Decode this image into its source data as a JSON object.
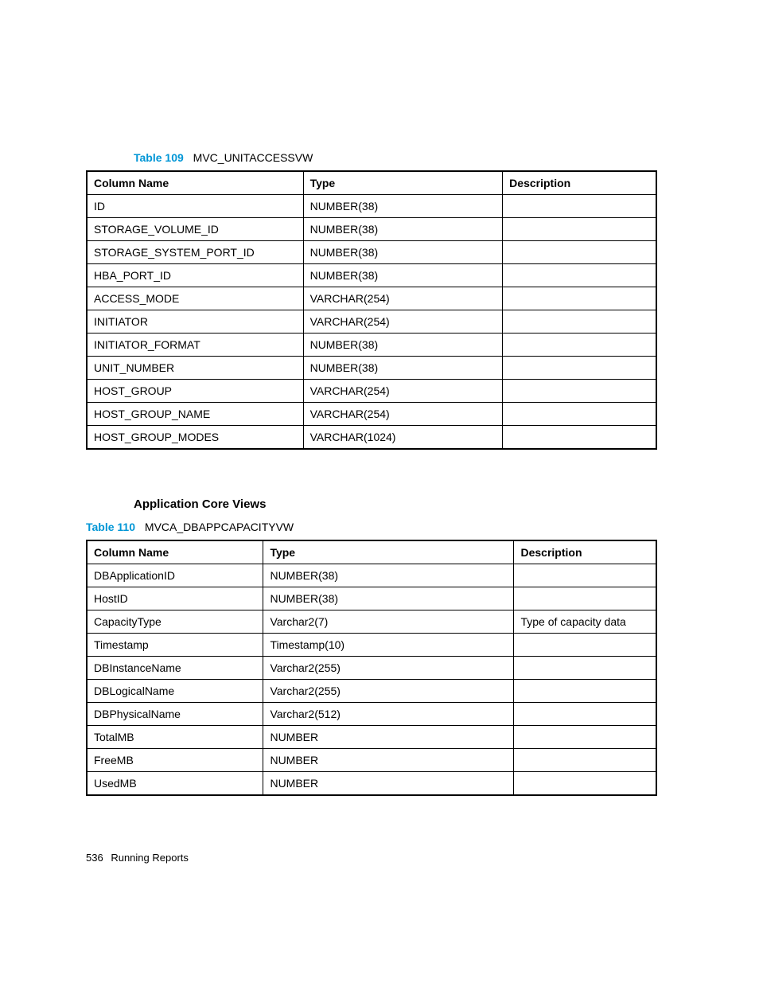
{
  "table1": {
    "caption_label": "Table 109",
    "caption_name": "MVC_UNITACCESSVW",
    "headers": {
      "col1": "Column Name",
      "col2": "Type",
      "col3": "Description"
    },
    "rows": [
      {
        "col1": "ID",
        "col2": "NUMBER(38)",
        "col3": ""
      },
      {
        "col1": "STORAGE_VOLUME_ID",
        "col2": "NUMBER(38)",
        "col3": ""
      },
      {
        "col1": "STORAGE_SYSTEM_PORT_ID",
        "col2": "NUMBER(38)",
        "col3": ""
      },
      {
        "col1": "HBA_PORT_ID",
        "col2": "NUMBER(38)",
        "col3": ""
      },
      {
        "col1": "ACCESS_MODE",
        "col2": "VARCHAR(254)",
        "col3": ""
      },
      {
        "col1": "INITIATOR",
        "col2": "VARCHAR(254)",
        "col3": ""
      },
      {
        "col1": "INITIATOR_FORMAT",
        "col2": "NUMBER(38)",
        "col3": ""
      },
      {
        "col1": "UNIT_NUMBER",
        "col2": "NUMBER(38)",
        "col3": ""
      },
      {
        "col1": "HOST_GROUP",
        "col2": "VARCHAR(254)",
        "col3": ""
      },
      {
        "col1": "HOST_GROUP_NAME",
        "col2": "VARCHAR(254)",
        "col3": ""
      },
      {
        "col1": "HOST_GROUP_MODES",
        "col2": "VARCHAR(1024)",
        "col3": ""
      }
    ]
  },
  "section_heading": "Application Core Views",
  "table2": {
    "caption_label": "Table 110",
    "caption_name": "MVCA_DBAPPCAPACITYVW",
    "headers": {
      "col1": "Column Name",
      "col2": "Type",
      "col3": "Description"
    },
    "rows": [
      {
        "col1": "DBApplicationID",
        "col2": "NUMBER(38)",
        "col3": ""
      },
      {
        "col1": "HostID",
        "col2": "NUMBER(38)",
        "col3": ""
      },
      {
        "col1": "CapacityType",
        "col2": "Varchar2(7)",
        "col3": "Type of capacity data"
      },
      {
        "col1": "Timestamp",
        "col2": "Timestamp(10)",
        "col3": ""
      },
      {
        "col1": "DBInstanceName",
        "col2": "Varchar2(255)",
        "col3": ""
      },
      {
        "col1": "DBLogicalName",
        "col2": "Varchar2(255)",
        "col3": ""
      },
      {
        "col1": "DBPhysicalName",
        "col2": "Varchar2(512)",
        "col3": ""
      },
      {
        "col1": "TotalMB",
        "col2": "NUMBER",
        "col3": ""
      },
      {
        "col1": "FreeMB",
        "col2": "NUMBER",
        "col3": ""
      },
      {
        "col1": "UsedMB",
        "col2": "NUMBER",
        "col3": ""
      }
    ]
  },
  "footer": {
    "page_number": "536",
    "section": "Running Reports"
  }
}
